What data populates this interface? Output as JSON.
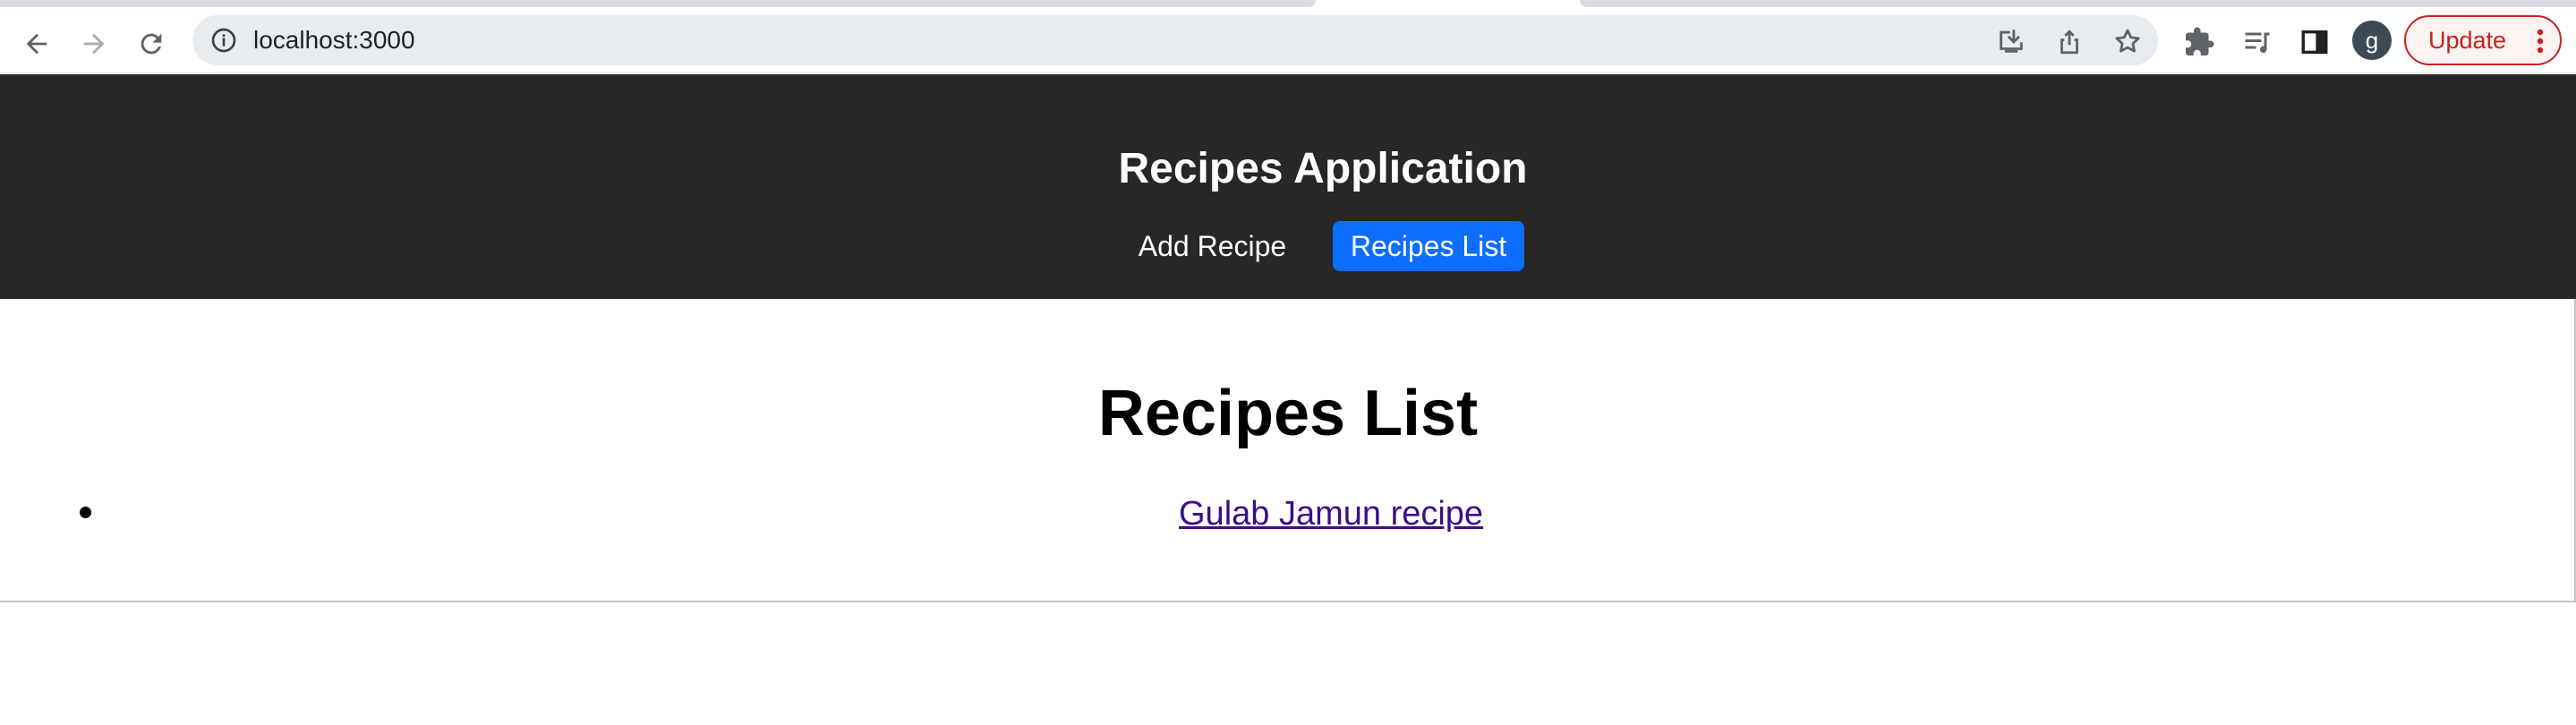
{
  "browser": {
    "url": "localhost:3000",
    "avatar_letter": "g",
    "update_label": "Update"
  },
  "app": {
    "title": "Recipes Application",
    "nav": {
      "add_recipe": "Add Recipe",
      "recipes_list": "Recipes List",
      "active": "recipes_list"
    }
  },
  "page": {
    "heading": "Recipes List",
    "recipes": [
      {
        "title": "Gulab Jamun recipe"
      }
    ]
  },
  "colors": {
    "header_bg": "#272727",
    "active_nav_bg": "#0d6efd",
    "visited_link": "#3b0e8c",
    "update_red": "#c5221f"
  },
  "icons": {
    "back": "arrow-left-icon",
    "forward": "arrow-right-icon",
    "reload": "reload-icon",
    "site_info": "info-icon",
    "install": "install-app-icon",
    "share": "share-icon",
    "bookmark": "star-icon",
    "extensions": "puzzle-icon",
    "media": "media-controls-icon",
    "side_panel": "side-panel-icon",
    "menu": "three-dots-icon"
  }
}
